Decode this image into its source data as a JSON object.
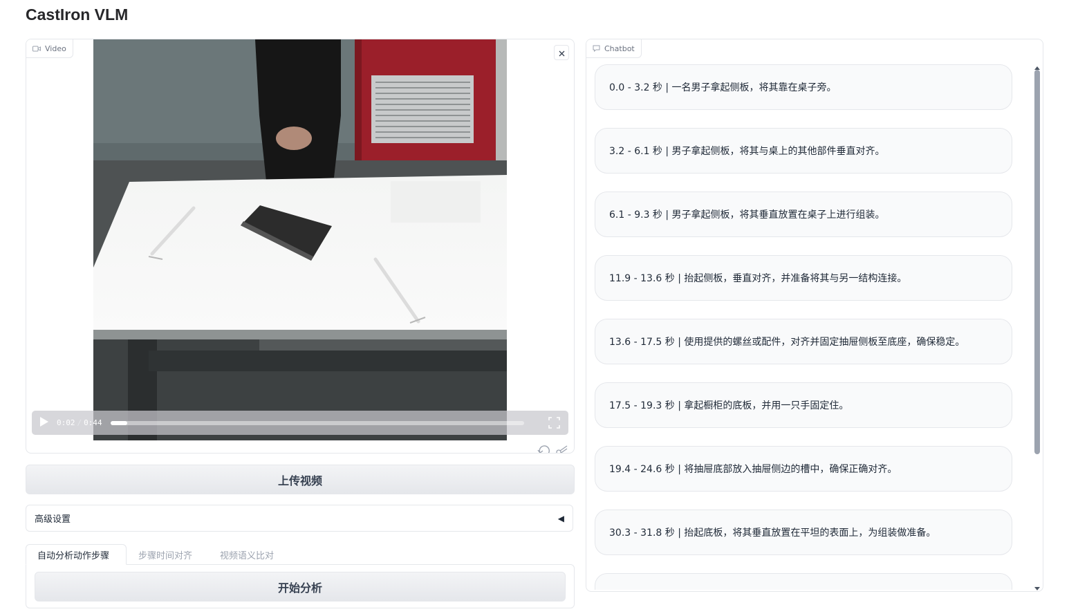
{
  "app": {
    "title": "CastIron VLM"
  },
  "video": {
    "label": "Video",
    "current_time": "0:02",
    "duration": "0:44",
    "progress_fraction": 0.04
  },
  "upload_button": "上传视频",
  "advanced": {
    "label": "高级设置",
    "toggle_glyph": "◀"
  },
  "tabs": [
    {
      "label": "自动分析动作步骤",
      "active": true
    },
    {
      "label": "步骤时间对齐",
      "active": false
    },
    {
      "label": "视频语义比对",
      "active": false
    }
  ],
  "analyze_button": "开始分析",
  "chatbot": {
    "label": "Chatbot",
    "messages": [
      "0.0 - 3.2 秒 | 一名男子拿起侧板，将其靠在桌子旁。",
      "3.2 - 6.1 秒 | 男子拿起侧板，将其与桌上的其他部件垂直对齐。",
      "6.1 - 9.3 秒 | 男子拿起侧板，将其垂直放置在桌子上进行组装。",
      "11.9 - 13.6 秒 | 抬起侧板，垂直对齐，并准备将其与另一结构连接。",
      "13.6 - 17.5 秒 | 使用提供的螺丝或配件，对齐并固定抽屉侧板至底座，确保稳定。",
      "17.5 - 19.3 秒 | 拿起橱柜的底板，并用一只手固定住。",
      "19.4 - 24.6 秒 | 将抽屉底部放入抽屉侧边的槽中，确保正确对齐。",
      "30.3 - 31.8 秒 | 抬起底板，将其垂直放置在平坦的表面上，为组装做准备。",
      ""
    ]
  },
  "colors": {
    "border": "#e5e7eb",
    "button_bg": "#e5e7eb",
    "message_bg": "#f9fafb"
  }
}
